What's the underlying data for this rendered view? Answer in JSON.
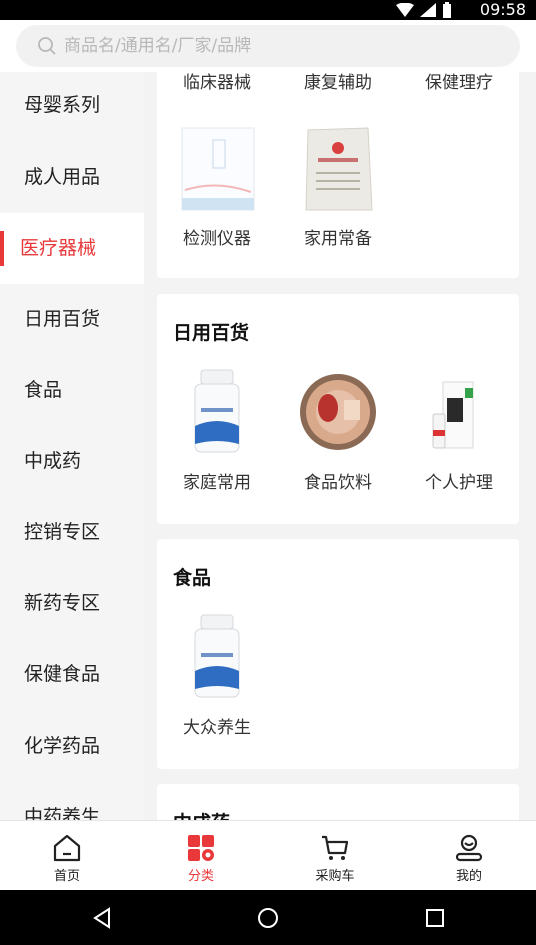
{
  "status_bar": {
    "time": "09:58"
  },
  "search": {
    "placeholder": "商品名/通用名/厂家/品牌"
  },
  "sidebar": {
    "items": [
      {
        "label": "母婴系列"
      },
      {
        "label": "成人用品"
      },
      {
        "label": "医疗器械",
        "active": true
      },
      {
        "label": "日用百货"
      },
      {
        "label": "食品"
      },
      {
        "label": "中成药"
      },
      {
        "label": "控销专区"
      },
      {
        "label": "新药专区"
      },
      {
        "label": "保健食品"
      },
      {
        "label": "化学药品"
      },
      {
        "label": "中药养生"
      }
    ]
  },
  "sections": {
    "medical": {
      "top_labels": [
        "临床器械",
        "康复辅助",
        "保健理疗"
      ],
      "products": [
        {
          "label": "检测仪器",
          "icon": "test-strip-box-image"
        },
        {
          "label": "家用常备",
          "icon": "medical-packet-image"
        }
      ]
    },
    "daily": {
      "title": "日用百货",
      "products": [
        {
          "label": "家庭常用",
          "icon": "pill-bottle-image"
        },
        {
          "label": "食品饮料",
          "icon": "turtle-jelly-image"
        },
        {
          "label": "个人护理",
          "icon": "personal-care-box-image"
        }
      ]
    },
    "food": {
      "title": "食品",
      "products": [
        {
          "label": "大众养生",
          "icon": "pill-bottle-image"
        }
      ]
    },
    "tcm": {
      "title": "中成药"
    }
  },
  "tabbar": {
    "items": [
      {
        "label": "首页",
        "icon": "home-icon"
      },
      {
        "label": "分类",
        "icon": "category-icon",
        "active": true
      },
      {
        "label": "采购车",
        "icon": "cart-icon"
      },
      {
        "label": "我的",
        "icon": "profile-icon"
      }
    ]
  },
  "colors": {
    "accent": "#e8383a",
    "background": "#f3f3f3"
  }
}
